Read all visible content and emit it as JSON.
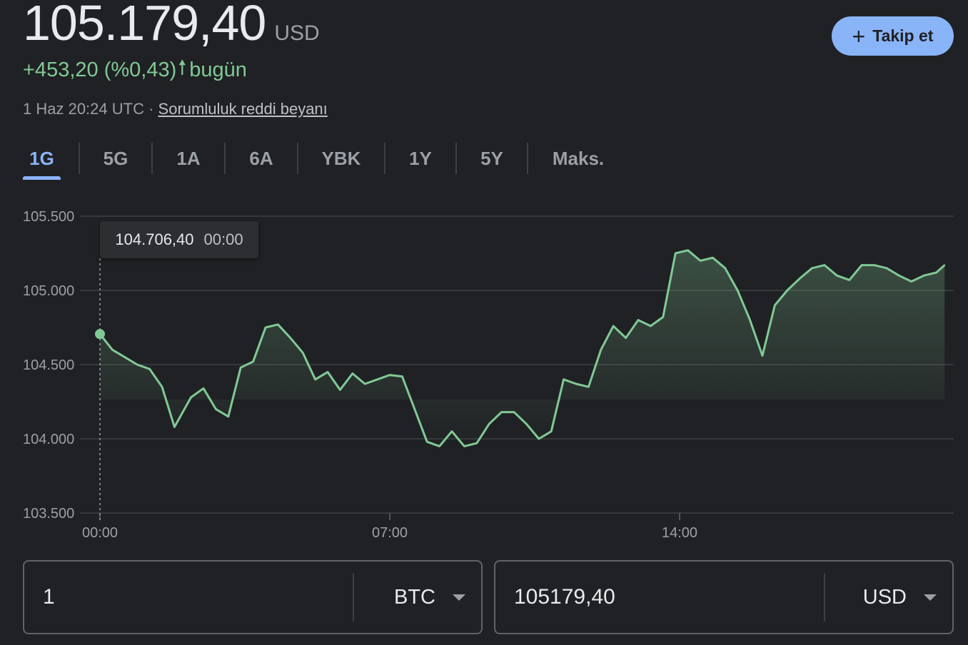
{
  "quote": {
    "price": "105.179,40",
    "currency": "USD",
    "change": "+453,20 (%0,43)",
    "change_period": "bugün",
    "timestamp": "1 Haz 20:24 UTC ·",
    "disclaimer": "Sorumluluk reddi beyanı"
  },
  "follow_button": {
    "label": "Takip et",
    "icon": "plus-icon"
  },
  "tabs": [
    {
      "label": "1G",
      "active": true
    },
    {
      "label": "5G"
    },
    {
      "label": "1A"
    },
    {
      "label": "6A"
    },
    {
      "label": "YBK"
    },
    {
      "label": "1Y"
    },
    {
      "label": "5Y"
    },
    {
      "label": "Maks."
    }
  ],
  "tooltip": {
    "value": "104.706,40",
    "time": "00:00"
  },
  "colors": {
    "background": "#202124",
    "accent": "#8ab4f8",
    "positive": "#81c995",
    "text_secondary": "#9aa0a6"
  },
  "chart_data": {
    "type": "area",
    "y_ticks": [
      "105.500",
      "105.000",
      "104.500",
      "104.000",
      "103.500"
    ],
    "x_ticks": [
      "00:00",
      "07:00",
      "14:00"
    ],
    "ylim": [
      103500,
      105500
    ],
    "xlim": [
      0,
      24
    ],
    "grid": true,
    "x_hours": [
      0.0,
      0.3,
      0.6,
      0.9,
      1.2,
      1.5,
      1.8,
      2.2,
      2.5,
      2.8,
      3.1,
      3.4,
      3.7,
      4.0,
      4.3,
      4.6,
      4.9,
      5.2,
      5.5,
      5.8,
      6.1,
      6.4,
      6.7,
      7.0,
      7.3,
      7.6,
      7.9,
      8.2,
      8.5,
      8.8,
      9.1,
      9.4,
      9.7,
      10.0,
      10.3,
      10.6,
      10.9,
      11.2,
      11.5,
      11.8,
      12.1,
      12.4,
      12.7,
      13.0,
      13.3,
      13.6,
      13.9,
      14.2,
      14.5,
      14.8,
      15.1,
      15.4,
      15.7,
      16.0,
      16.3,
      16.6,
      16.9,
      17.2,
      17.5,
      17.8,
      18.1,
      18.4,
      18.7,
      19.0,
      19.3,
      19.6,
      19.9,
      20.2,
      20.4
    ],
    "values": [
      104706,
      104600,
      104550,
      104500,
      104470,
      104350,
      104080,
      104280,
      104340,
      104200,
      104150,
      104480,
      104520,
      104750,
      104770,
      104680,
      104580,
      104400,
      104450,
      104330,
      104440,
      104370,
      104400,
      104430,
      104420,
      104200,
      103980,
      103950,
      104050,
      103950,
      103970,
      104100,
      104180,
      104180,
      104100,
      104000,
      104050,
      104400,
      104370,
      104350,
      104600,
      104760,
      104680,
      104800,
      104760,
      104820,
      105250,
      105270,
      105200,
      105220,
      105150,
      105000,
      104800,
      104560,
      104900,
      105000,
      105080,
      105150,
      105170,
      105100,
      105070,
      105170,
      105170,
      105150,
      105100,
      105060,
      105100,
      105120,
      105170
    ]
  },
  "converter": {
    "from_value": "1",
    "from_unit": "BTC",
    "to_value": "105179,40",
    "to_unit": "USD"
  }
}
